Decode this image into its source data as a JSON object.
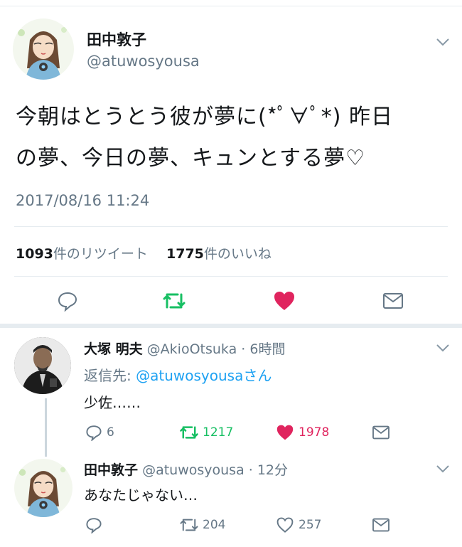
{
  "main_tweet": {
    "display_name": "田中敦子",
    "handle": "@atuwosyousa",
    "text_line1": "今朝はとうとう彼が夢に(*ﾟ∀ﾟ*) 昨日",
    "text_line2": "の夢、今日の夢、キュンとする夢♡",
    "timestamp": "2017/08/16 11:24",
    "retweet_count": "1093",
    "retweet_label": "件のリツイート",
    "like_count": "1775",
    "like_label": "件のいいね"
  },
  "reply1": {
    "display_name": "大塚 明夫",
    "handle_time": "@AkioOtsuka · 6時間",
    "reply_prefix": "返信先: ",
    "reply_to": "@atuwosyousaさん",
    "text": "少佐……",
    "reply_count": "6",
    "retweet_count": "1217",
    "like_count": "1978"
  },
  "reply2": {
    "display_name": "田中敦子",
    "handle_time": "@atuwosyousa · 12分",
    "text": "あなたじゃない…",
    "reply_count": "",
    "retweet_count": "204",
    "like_count": "257"
  },
  "colors": {
    "accent": "#1da1f2",
    "retweet": "#17bf63",
    "like": "#e0245e",
    "secondary_text": "#657786",
    "divider": "#e6ecf0"
  },
  "icons": [
    "chevron-down-icon",
    "reply-icon",
    "retweet-icon",
    "heart-icon",
    "dm-icon"
  ]
}
